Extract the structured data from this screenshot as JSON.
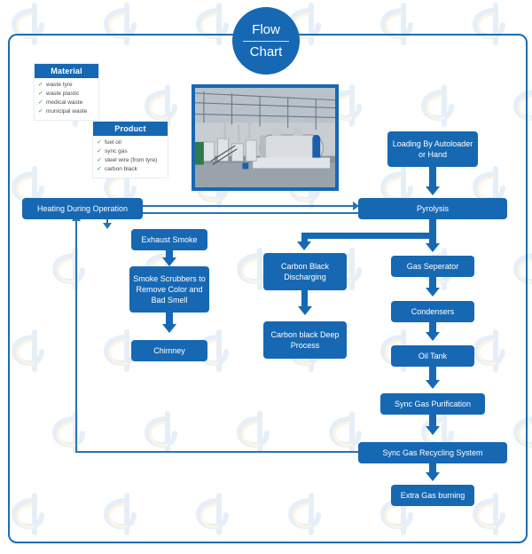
{
  "title": {
    "line1": "Flow",
    "line2": "Chart"
  },
  "panels": [
    {
      "id": "material",
      "header": "Material",
      "items": [
        "waste tyre",
        "waste plastic",
        "medical waste",
        "municipal waste"
      ],
      "check": "✓"
    },
    {
      "id": "product",
      "header": "Product",
      "items": [
        "fuel oil",
        "sync gas",
        "steel wire (from tyre)",
        "carbon black"
      ],
      "check": "✓"
    }
  ],
  "photo": {
    "alt_name": "pyrolysis-plant-photo"
  },
  "nodes": {
    "loading": "Loading By Autoloader or Hand",
    "pyrolysis": "Pyrolysis",
    "heating": "Heating During Operation",
    "exhaust_smoke": "Exhaust Smoke",
    "smoke_scrubbers": "Smoke Scrubbers to Remove Color and Bad Smell",
    "chimney": "Chimney",
    "carbon_black_discharging": "Carbon Black Discharging",
    "carbon_black_deep_process": "Carbon black Deep Process",
    "gas_seperator": "Gas Seperator",
    "condensers": "Condensers",
    "oil_tank": "Oil Tank",
    "sync_gas_purification": "Sync Gas Purification",
    "sync_gas_recycling": "Sync Gas Recycling System",
    "extra_gas_burning": "Extra Gas burning"
  },
  "colors": {
    "box_fill": "#1668b3",
    "frame_border": "#1a6db5",
    "connector": "#1668b3",
    "thin_connector": "#2a73b0",
    "check_green": "#3aa03a",
    "box_text": "#ffffff",
    "list_text": "#4a4a4a"
  }
}
